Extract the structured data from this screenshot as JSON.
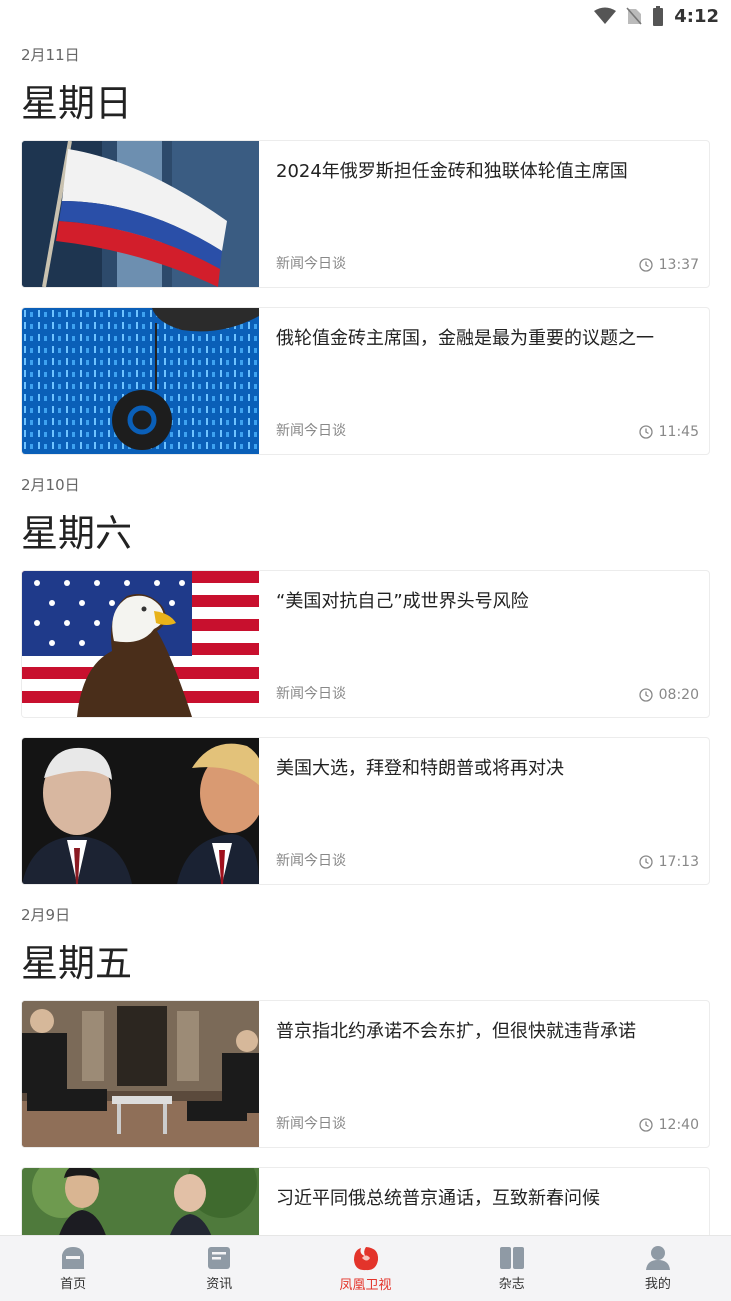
{
  "status_bar": {
    "time": "4:12"
  },
  "sections": [
    {
      "date": "2月11日",
      "weekday": "星期日",
      "articles": [
        {
          "title": "2024年俄罗斯担任金砖和独联体轮值主席国",
          "source": "新闻今日谈",
          "time": "13:37",
          "image": "russian-flag-skyscrapers"
        },
        {
          "title": "俄轮值金砖主席国，金融是最为重要的议题之一",
          "source": "新闻今日谈",
          "time": "11:45",
          "image": "binary-code-at-sign"
        }
      ]
    },
    {
      "date": "2月10日",
      "weekday": "星期六",
      "articles": [
        {
          "title": "“美国对抗自己”成世界头号风险",
          "source": "新闻今日谈",
          "time": "08:20",
          "image": "eagle-us-flag"
        },
        {
          "title": "美国大选，拜登和特朗普或将再对决",
          "source": "新闻今日谈",
          "time": "17:13",
          "image": "two-politicians"
        }
      ]
    },
    {
      "date": "2月9日",
      "weekday": "星期五",
      "articles": [
        {
          "title": "普京指北约承诺不会东扩，但很快就违背承诺",
          "source": "新闻今日谈",
          "time": "12:40",
          "image": "interview-room"
        },
        {
          "title": "习近平同俄总统普京通话，互致新春问候",
          "source": "",
          "time": "",
          "image": "two-leaders-outdoor"
        }
      ]
    }
  ],
  "tabbar": {
    "items": [
      {
        "label": "首页",
        "icon": "home-icon",
        "active": false
      },
      {
        "label": "资讯",
        "icon": "news-icon",
        "active": false
      },
      {
        "label": "凤凰卫视",
        "icon": "phoenix-icon",
        "active": true
      },
      {
        "label": "杂志",
        "icon": "magazine-icon",
        "active": false
      },
      {
        "label": "我的",
        "icon": "profile-icon",
        "active": false
      }
    ]
  },
  "colors": {
    "accent": "#e3342b",
    "tab_icon": "#8f9aa5"
  }
}
